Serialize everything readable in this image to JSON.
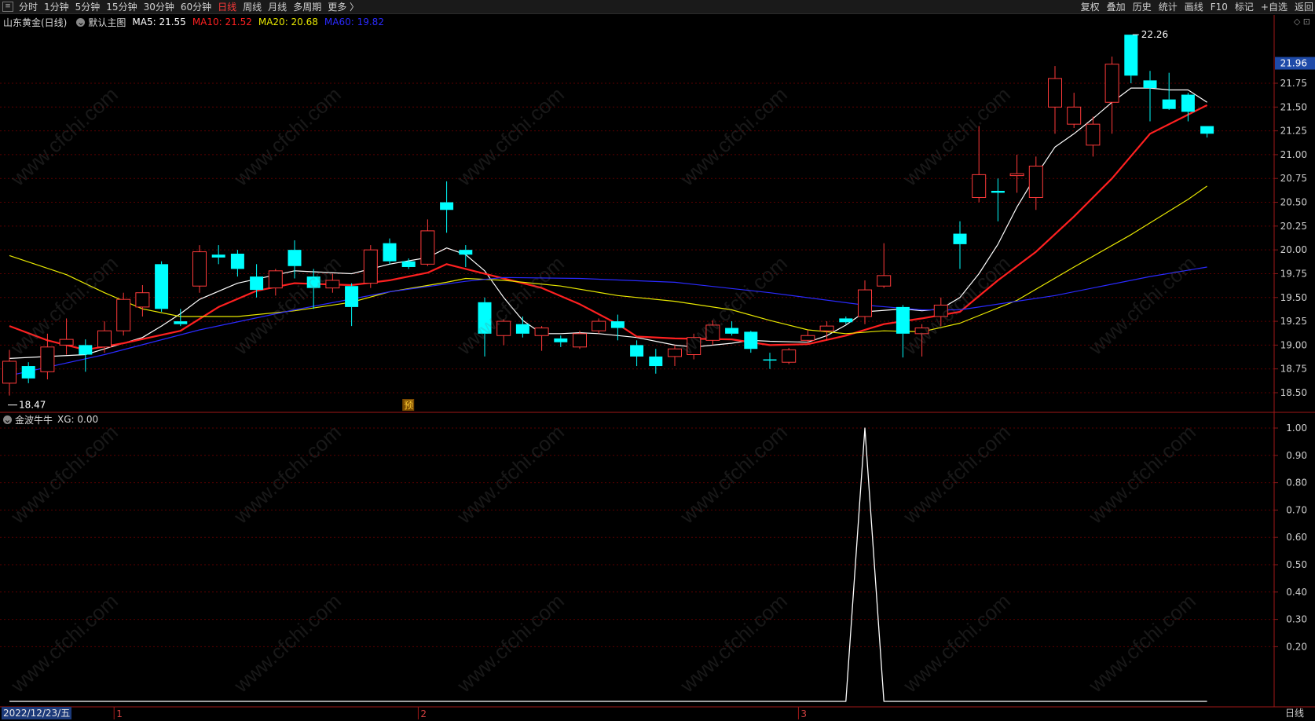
{
  "toolbar": {
    "periods": [
      "分时",
      "1分钟",
      "5分钟",
      "15分钟",
      "30分钟",
      "60分钟",
      "日线",
      "周线",
      "月线",
      "多周期",
      "更多 〉"
    ],
    "active_period": "日线",
    "right_tools": [
      "复权",
      "叠加",
      "历史",
      "统计",
      "画线",
      "F10",
      "标记",
      "+自选",
      "返回"
    ]
  },
  "main_panel": {
    "stock": "山东黄金(日线)",
    "template": "默认主图",
    "ma": [
      {
        "label": "MA5: 21.55",
        "color": "#ffffff"
      },
      {
        "label": "MA10: 21.52",
        "color": "#ff2020"
      },
      {
        "label": "MA20: 20.68",
        "color": "#e8e800"
      },
      {
        "label": "MA60: 19.82",
        "color": "#2a2aff"
      }
    ],
    "top_right": "◇ ⊡"
  },
  "sub_panel": {
    "indicator": "金波牛牛",
    "value_label": "XG: 0.00"
  },
  "footer": {
    "date": "2022/12/23/五",
    "period": "日线",
    "months": [
      "1",
      "2",
      "3"
    ]
  },
  "watermark": "www.cfchi.com",
  "chart_data": [
    {
      "type": "candlestick",
      "title": "山东黄金(日线)",
      "y_ticks": [
        18.5,
        18.75,
        19.0,
        19.25,
        19.5,
        19.75,
        20.0,
        20.25,
        20.5,
        20.75,
        21.0,
        21.25,
        21.5,
        21.75
      ],
      "ylim": [
        18.28,
        22.41
      ],
      "last_price": 21.96,
      "high_annotation": {
        "index": 59,
        "value": 22.26,
        "label": "22.26"
      },
      "low_annotation": {
        "index": 0,
        "value": 18.47,
        "label": "18.47"
      },
      "special_marker": {
        "index": 21,
        "label": "预"
      },
      "month_starts": [
        {
          "label": "1",
          "index": 6
        },
        {
          "label": "2",
          "index": 22
        },
        {
          "label": "3",
          "index": 42
        }
      ],
      "up_color": "#ff3a3a",
      "down_color": "#00ffff",
      "candles": [
        {
          "o": 18.6,
          "h": 18.95,
          "l": 18.47,
          "c": 18.83
        },
        {
          "o": 18.78,
          "h": 18.82,
          "l": 18.6,
          "c": 18.65
        },
        {
          "o": 18.72,
          "h": 19.12,
          "l": 18.64,
          "c": 18.98
        },
        {
          "o": 19.0,
          "h": 19.28,
          "l": 18.9,
          "c": 19.06
        },
        {
          "o": 19.0,
          "h": 19.06,
          "l": 18.72,
          "c": 18.9
        },
        {
          "o": 18.98,
          "h": 19.25,
          "l": 18.92,
          "c": 19.15
        },
        {
          "o": 19.15,
          "h": 19.55,
          "l": 19.1,
          "c": 19.48
        },
        {
          "o": 19.4,
          "h": 19.63,
          "l": 19.3,
          "c": 19.55
        },
        {
          "o": 19.85,
          "h": 19.88,
          "l": 19.35,
          "c": 19.38
        },
        {
          "o": 19.25,
          "h": 19.38,
          "l": 19.2,
          "c": 19.22
        },
        {
          "o": 19.62,
          "h": 20.05,
          "l": 19.55,
          "c": 19.98
        },
        {
          "o": 19.95,
          "h": 20.05,
          "l": 19.85,
          "c": 19.92
        },
        {
          "o": 19.96,
          "h": 20.0,
          "l": 19.72,
          "c": 19.8
        },
        {
          "o": 19.72,
          "h": 19.85,
          "l": 19.5,
          "c": 19.58
        },
        {
          "o": 19.6,
          "h": 19.8,
          "l": 19.52,
          "c": 19.78
        },
        {
          "o": 20.0,
          "h": 20.1,
          "l": 19.7,
          "c": 19.83
        },
        {
          "o": 19.72,
          "h": 19.8,
          "l": 19.38,
          "c": 19.6
        },
        {
          "o": 19.6,
          "h": 19.75,
          "l": 19.55,
          "c": 19.68
        },
        {
          "o": 19.62,
          "h": 19.65,
          "l": 19.2,
          "c": 19.4
        },
        {
          "o": 19.65,
          "h": 20.05,
          "l": 19.6,
          "c": 20.0
        },
        {
          "o": 20.07,
          "h": 20.12,
          "l": 19.85,
          "c": 19.88
        },
        {
          "o": 19.88,
          "h": 19.91,
          "l": 19.8,
          "c": 19.82
        },
        {
          "o": 19.85,
          "h": 20.32,
          "l": 19.83,
          "c": 20.2
        },
        {
          "o": 20.5,
          "h": 20.72,
          "l": 20.18,
          "c": 20.42
        },
        {
          "o": 20.0,
          "h": 20.05,
          "l": 19.82,
          "c": 19.95
        },
        {
          "o": 19.45,
          "h": 19.5,
          "l": 18.88,
          "c": 19.12
        },
        {
          "o": 19.1,
          "h": 19.27,
          "l": 19.0,
          "c": 19.25
        },
        {
          "o": 19.22,
          "h": 19.3,
          "l": 19.08,
          "c": 19.12
        },
        {
          "o": 19.1,
          "h": 19.2,
          "l": 18.94,
          "c": 19.18
        },
        {
          "o": 19.07,
          "h": 19.1,
          "l": 18.98,
          "c": 19.03
        },
        {
          "o": 18.98,
          "h": 19.15,
          "l": 18.96,
          "c": 19.12
        },
        {
          "o": 19.15,
          "h": 19.28,
          "l": 19.12,
          "c": 19.25
        },
        {
          "o": 19.25,
          "h": 19.32,
          "l": 19.05,
          "c": 19.18
        },
        {
          "o": 19.0,
          "h": 19.05,
          "l": 18.78,
          "c": 18.88
        },
        {
          "o": 18.88,
          "h": 18.96,
          "l": 18.7,
          "c": 18.78
        },
        {
          "o": 18.88,
          "h": 19.0,
          "l": 18.78,
          "c": 18.96
        },
        {
          "o": 18.9,
          "h": 19.12,
          "l": 18.85,
          "c": 19.08
        },
        {
          "o": 19.05,
          "h": 19.26,
          "l": 19.0,
          "c": 19.21
        },
        {
          "o": 19.18,
          "h": 19.25,
          "l": 19.1,
          "c": 19.12
        },
        {
          "o": 19.14,
          "h": 19.15,
          "l": 18.92,
          "c": 18.96
        },
        {
          "o": 18.85,
          "h": 18.92,
          "l": 18.75,
          "c": 18.84
        },
        {
          "o": 18.82,
          "h": 18.97,
          "l": 18.8,
          "c": 18.95
        },
        {
          "o": 19.05,
          "h": 19.16,
          "l": 19.02,
          "c": 19.1
        },
        {
          "o": 19.15,
          "h": 19.25,
          "l": 19.05,
          "c": 19.2
        },
        {
          "o": 19.28,
          "h": 19.3,
          "l": 19.22,
          "c": 19.24
        },
        {
          "o": 19.3,
          "h": 19.68,
          "l": 19.22,
          "c": 19.58
        },
        {
          "o": 19.62,
          "h": 20.07,
          "l": 19.6,
          "c": 19.73
        },
        {
          "o": 19.4,
          "h": 19.42,
          "l": 18.87,
          "c": 19.12
        },
        {
          "o": 19.12,
          "h": 19.22,
          "l": 18.88,
          "c": 19.18
        },
        {
          "o": 19.3,
          "h": 19.5,
          "l": 19.2,
          "c": 19.42
        },
        {
          "o": 20.17,
          "h": 20.3,
          "l": 19.8,
          "c": 20.06
        },
        {
          "o": 20.55,
          "h": 21.3,
          "l": 20.5,
          "c": 20.79
        },
        {
          "o": 20.62,
          "h": 20.75,
          "l": 20.3,
          "c": 20.6
        },
        {
          "o": 20.78,
          "h": 21.0,
          "l": 20.6,
          "c": 20.8
        },
        {
          "o": 20.55,
          "h": 20.98,
          "l": 20.42,
          "c": 20.88
        },
        {
          "o": 21.5,
          "h": 21.93,
          "l": 21.22,
          "c": 21.8
        },
        {
          "o": 21.32,
          "h": 21.65,
          "l": 21.28,
          "c": 21.5
        },
        {
          "o": 21.1,
          "h": 21.4,
          "l": 20.98,
          "c": 21.32
        },
        {
          "o": 21.55,
          "h": 22.03,
          "l": 21.22,
          "c": 21.95
        },
        {
          "o": 22.26,
          "h": 22.26,
          "l": 21.75,
          "c": 21.83
        },
        {
          "o": 21.78,
          "h": 21.88,
          "l": 21.35,
          "c": 21.7
        },
        {
          "o": 21.58,
          "h": 21.86,
          "l": 21.47,
          "c": 21.48
        },
        {
          "o": 21.63,
          "h": 21.65,
          "l": 21.35,
          "c": 21.45
        },
        {
          "o": 21.3,
          "h": 21.3,
          "l": 21.18,
          "c": 21.22
        }
      ],
      "ma": {
        "MA5": {
          "color": "#ffffff",
          "x": [
            0,
            1,
            4,
            7,
            8,
            9,
            10,
            12,
            15,
            18,
            20,
            22,
            23,
            24,
            25,
            26,
            27,
            28,
            29,
            30,
            31,
            33,
            35,
            36,
            38,
            39,
            40,
            42,
            43,
            44,
            45,
            47,
            48,
            49,
            50,
            51,
            52,
            53,
            54,
            55,
            56,
            57,
            58,
            59,
            60,
            61,
            62,
            63
          ],
          "values": [
            18.86,
            18.87,
            18.9,
            19.08,
            19.2,
            19.33,
            19.48,
            19.65,
            19.78,
            19.75,
            19.85,
            19.92,
            20.02,
            19.95,
            19.78,
            19.5,
            19.26,
            19.12,
            19.12,
            19.13,
            19.12,
            19.08,
            19.0,
            18.98,
            19.02,
            19.05,
            19.04,
            19.03,
            19.1,
            19.21,
            19.35,
            19.38,
            19.36,
            19.38,
            19.5,
            19.75,
            20.06,
            20.45,
            20.78,
            21.08,
            21.22,
            21.38,
            21.55,
            21.7,
            21.7,
            21.68,
            21.68,
            21.55
          ]
        },
        "MA10": {
          "color": "#ff2020",
          "x": [
            0,
            2,
            4,
            6,
            9,
            11,
            13,
            15,
            18,
            20,
            22,
            23,
            24,
            26,
            28,
            30,
            32,
            33,
            35,
            38,
            40,
            42,
            44,
            46,
            48,
            50,
            52,
            54,
            56,
            58,
            60,
            62,
            63
          ],
          "values": [
            19.2,
            19.05,
            18.95,
            19.02,
            19.15,
            19.4,
            19.57,
            19.65,
            19.63,
            19.68,
            19.76,
            19.85,
            19.8,
            19.7,
            19.6,
            19.43,
            19.22,
            19.09,
            19.07,
            19.06,
            19.0,
            19.01,
            19.1,
            19.22,
            19.28,
            19.35,
            19.68,
            19.98,
            20.35,
            20.75,
            21.22,
            21.42,
            21.52
          ]
        },
        "MA20": {
          "color": "#e8e800",
          "x": [
            0,
            3,
            5,
            7,
            9,
            12,
            15,
            18,
            20,
            23,
            24,
            26,
            29,
            32,
            35,
            38,
            40,
            42,
            44,
            46,
            48,
            50,
            53,
            56,
            59,
            62,
            63
          ],
          "values": [
            19.94,
            19.74,
            19.55,
            19.38,
            19.3,
            19.3,
            19.36,
            19.45,
            19.56,
            19.66,
            19.7,
            19.68,
            19.62,
            19.52,
            19.46,
            19.37,
            19.26,
            19.16,
            19.12,
            19.15,
            19.14,
            19.23,
            19.47,
            19.82,
            20.16,
            20.53,
            20.67
          ]
        },
        "MA60": {
          "color": "#2a2aff",
          "x": [
            0,
            5,
            10,
            15,
            20,
            24,
            26,
            30,
            35,
            40,
            45,
            48,
            50,
            55,
            60,
            63
          ],
          "values": [
            18.68,
            18.9,
            19.16,
            19.37,
            19.56,
            19.67,
            19.71,
            19.7,
            19.66,
            19.55,
            19.42,
            19.37,
            19.37,
            19.52,
            19.72,
            19.82
          ]
        }
      }
    },
    {
      "type": "line",
      "title": "金波牛牛",
      "series": [
        {
          "name": "XG",
          "color": "#ffffff",
          "x": [
            0,
            44,
            45,
            46,
            63
          ],
          "values": [
            0,
            0,
            1,
            0,
            0
          ]
        }
      ],
      "y_ticks": [
        "1.00",
        "0.90",
        "0.80",
        "0.70",
        "0.60",
        "0.50",
        "0.40",
        "0.30",
        "0.20"
      ],
      "ylim": [
        0,
        1
      ]
    }
  ]
}
